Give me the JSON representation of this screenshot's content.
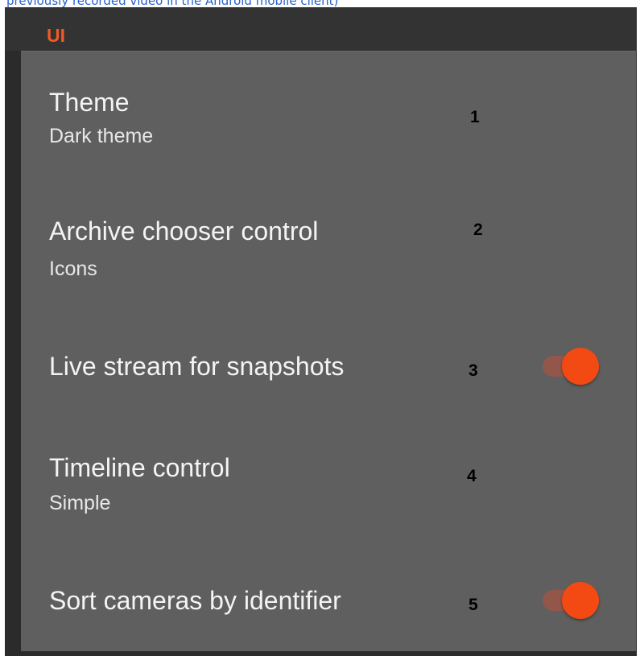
{
  "caption": "previously recorded video in the Android mobile client)",
  "section": {
    "title": "UI"
  },
  "settings": [
    {
      "number": "1",
      "title": "Theme",
      "value": "Dark theme"
    },
    {
      "number": "2",
      "title": "Archive chooser control",
      "value": "Icons"
    },
    {
      "number": "3",
      "title": "Live stream for snapshots",
      "toggle": true
    },
    {
      "number": "4",
      "title": "Timeline control",
      "value": "Simple"
    },
    {
      "number": "5",
      "title": "Sort cameras by identifier",
      "toggle": true
    }
  ],
  "colors": {
    "accent": "#f15a24",
    "toggle_thumb": "#f24a12",
    "toggle_track": "#92574a",
    "panel": "#5f5f5f",
    "header": "#333333",
    "caption_link": "#2a62c9"
  }
}
